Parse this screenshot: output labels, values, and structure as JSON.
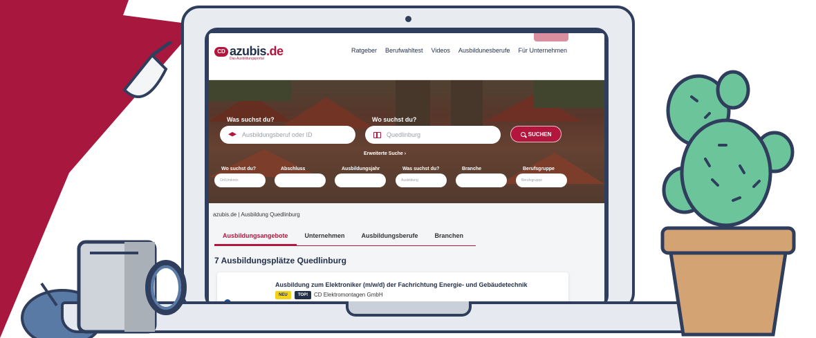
{
  "colors": {
    "brand": "#b3163c",
    "navy": "#22304a",
    "frame": "#2f3e5c",
    "cactus": "#6cc49b",
    "pot": "#d4a373"
  },
  "header": {
    "logo_mark": "CD",
    "logo_main": "azubis",
    "logo_tld": ".de",
    "tagline": "Das Ausbildungsportal",
    "nav": [
      "Ratgeber",
      "Berufwahltest",
      "Videos",
      "Ausbildunesberufe",
      "Für Unternehmen"
    ]
  },
  "hero": {
    "what_label": "Was suchst du?",
    "where_label": "Wo suchst du?",
    "what_placeholder": "Ausbildungsberuf oder ID",
    "where_placeholder": "Quedlinburg",
    "search_button": "SUCHEN",
    "extended_search": "Erweiterte Suche",
    "filters": [
      {
        "label": "Wo suchst du?",
        "placeholder": "Ort/Umkreis"
      },
      {
        "label": "Abschluss",
        "placeholder": ""
      },
      {
        "label": "Ausbildungsjahr",
        "placeholder": ""
      },
      {
        "label": "Was suchst du?",
        "placeholder": "Ausbildung"
      },
      {
        "label": "Branche",
        "placeholder": ""
      },
      {
        "label": "Berufsgruppe",
        "placeholder": "Berufsgruppe"
      }
    ]
  },
  "breadcrumb": "azubis.de  |  Ausbildung Quedlinburg",
  "tabs": [
    "Ausbildungsangebote",
    "Unternehmen",
    "Ausbildungsberufe",
    "Branchen"
  ],
  "results_title": "7 Ausbildungsplätze Quedlinburg",
  "result": {
    "title": "Ausbildung zum Elektroniker (m/w/d) der Fachrichtung Energie- und Gebäudetechnik",
    "badge_new": "NEU",
    "badge_top": "TOP!",
    "company": "CD Elektromontagen GmbH"
  }
}
